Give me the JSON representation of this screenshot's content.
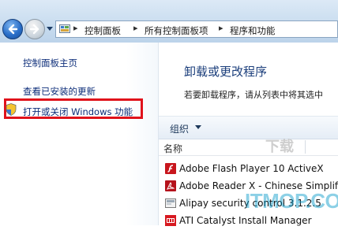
{
  "nav": {
    "breadcrumbs": [
      "控制面板",
      "所有控制面板项",
      "程序和功能"
    ],
    "separator": "▸"
  },
  "sidebar": {
    "items": [
      {
        "label": "控制面板主页"
      },
      {
        "label": "查看已安装的更新"
      },
      {
        "label": "打开或关闭 Windows 功能",
        "highlighted": true
      }
    ]
  },
  "main": {
    "title": "卸载或更改程序",
    "subtitle": "若要卸载程序，请从列表中将其选中",
    "toolbar": {
      "organize_label": "组织"
    },
    "column_header": "名称",
    "programs": [
      {
        "name": "Adobe Flash Player 10 ActiveX",
        "icon": "flash-icon"
      },
      {
        "name": "Adobe Reader X - Chinese Simplifi",
        "icon": "adobe-reader-icon"
      },
      {
        "name": "Alipay security control 3.1.2.5",
        "icon": "alipay-icon"
      },
      {
        "name": "ATI Catalyst Install Manager",
        "icon": "ati-icon"
      }
    ]
  },
  "watermark": {
    "text": "ITMOP.COM",
    "small": "下载"
  },
  "colors": {
    "accent": "#0c2d79",
    "highlight_border": "#e0121b"
  }
}
